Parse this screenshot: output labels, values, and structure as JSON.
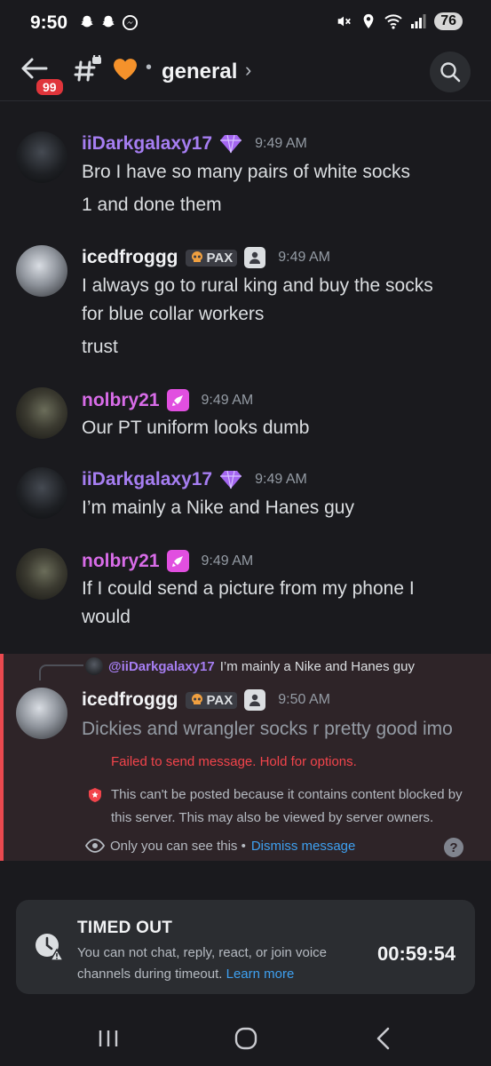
{
  "status_bar": {
    "time": "9:50",
    "battery": "76",
    "left_icons": [
      "snapchat-icon",
      "snapchat-icon",
      "messenger-icon"
    ],
    "right_icons": [
      "mute-icon",
      "location-icon",
      "wifi-icon",
      "signal-icon"
    ]
  },
  "header": {
    "unread_count": "99",
    "channel_icon": "hash-lock-icon",
    "channel_emoji": "orange-heart",
    "separator": "•",
    "channel_name": "general",
    "chevron": "›"
  },
  "messages": [
    {
      "author": "iiDarkgalaxy17",
      "author_color": "#a67ef2",
      "badge": "nitro-gem-icon",
      "timestamp": "9:49 AM",
      "lines": [
        "Bro I have so many pairs of white socks",
        "1 and done them"
      ]
    },
    {
      "author": "icedfroggg",
      "author_color": "#f2f3f5",
      "tag_emoji": "skull",
      "tag": "PAX",
      "badge": "member-icon",
      "timestamp": "9:49 AM",
      "lines": [
        "I always go to rural king and buy the socks",
        "for blue collar workers",
        "trust"
      ]
    },
    {
      "author": "nolbry21",
      "author_color": "#d86ce8",
      "badge": "server-boost-icon",
      "timestamp": "9:49 AM",
      "lines": [
        "Our PT uniform looks dumb"
      ]
    },
    {
      "author": "iiDarkgalaxy17",
      "author_color": "#a67ef2",
      "badge": "nitro-gem-icon",
      "timestamp": "9:49 AM",
      "lines": [
        "I’m mainly a Nike and Hanes guy"
      ]
    },
    {
      "author": "nolbry21",
      "author_color": "#d86ce8",
      "badge": "server-boost-icon",
      "timestamp": "9:49 AM",
      "lines": [
        "If I could send a picture from my phone I",
        "would"
      ]
    }
  ],
  "failed_message": {
    "reply_to_author": "@iiDarkgalaxy17",
    "reply_to_text": "I’m mainly a Nike and Hanes guy",
    "author": "icedfroggg",
    "tag_emoji": "skull",
    "tag": "PAX",
    "timestamp": "9:50 AM",
    "text": "Dickies and wrangler socks r pretty good imo",
    "error": "Failed to send message. Hold for options.",
    "blocked_note": "This can't be posted because it contains content blocked by this server. This may also be viewed by server owners.",
    "ephemeral_note": "Only you can see this •",
    "dismiss_label": "Dismiss message",
    "help_label": "?"
  },
  "timeout_card": {
    "title": "TIMED OUT",
    "description": "You can not chat, reply, react, or join voice channels during timeout.",
    "learn_more": "Learn more",
    "timer": "00:59:54"
  },
  "nav_bar": {
    "buttons": [
      "recent-apps-icon",
      "home-icon",
      "back-icon"
    ]
  },
  "colors": {
    "background": "#1a1a1e",
    "error": "#f2444b",
    "link": "#3ea0f0",
    "failed_bg": "#2e2428"
  }
}
